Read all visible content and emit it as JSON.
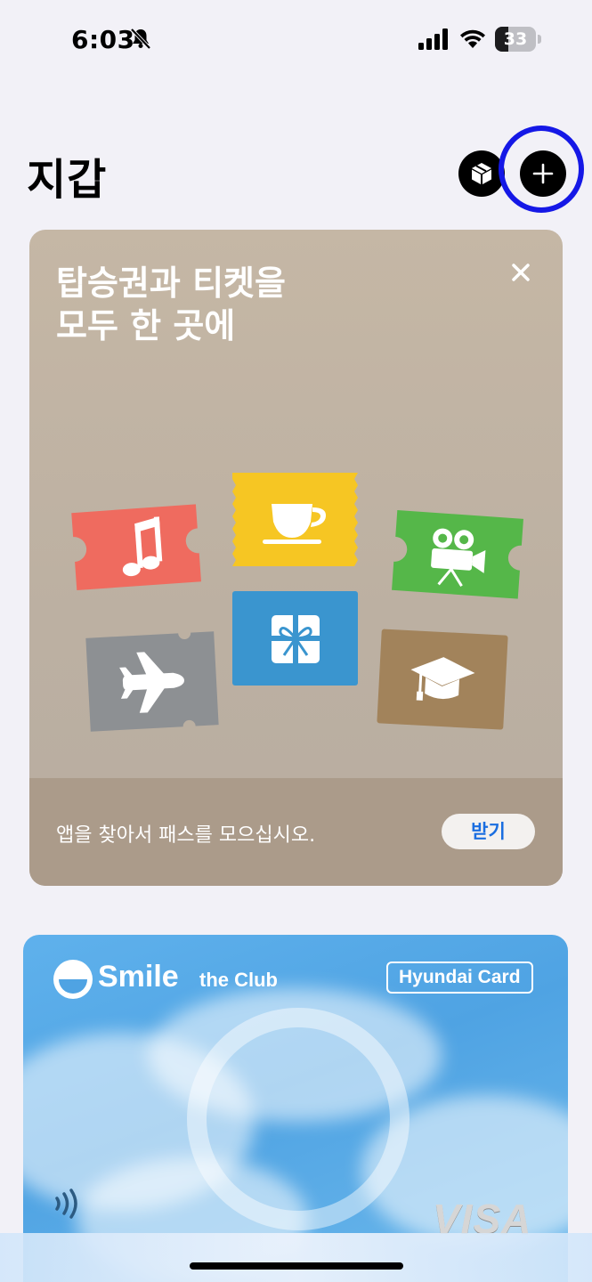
{
  "status_bar": {
    "time": "6:03",
    "battery": "33",
    "battery_level": 0.33
  },
  "header": {
    "title": "지갑"
  },
  "promo": {
    "title_line1": "탑승권과 티켓을",
    "title_line2": "모두 한 곳에",
    "footer_text": "앱을 찾아서 패스를 모으십시오.",
    "get_label": "받기",
    "colors": {
      "music": "#ef6b5f",
      "coffee": "#f6c623",
      "movie": "#55b749",
      "plane": "#8d9093",
      "gift": "#3a95cf",
      "education": "#a2835b"
    }
  },
  "card": {
    "brand": "Smile",
    "brand_sub": "the Club",
    "issuer": "Hyundai Card",
    "network": "VISA"
  },
  "accent": "#1518e6"
}
